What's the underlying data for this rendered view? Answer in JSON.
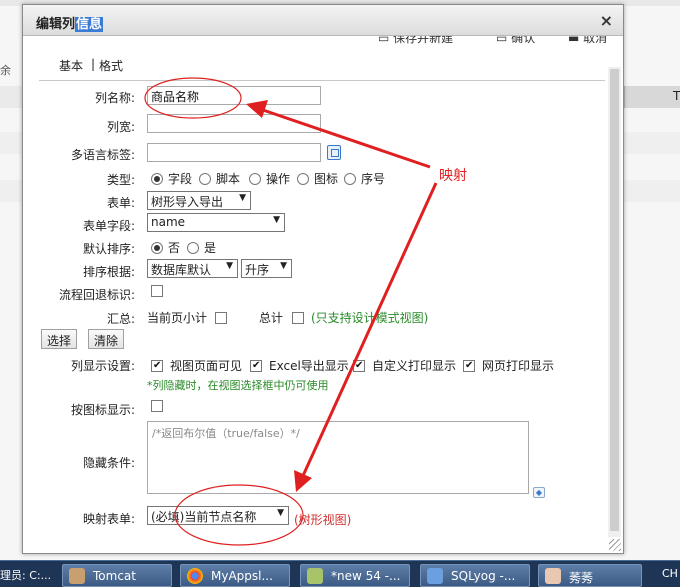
{
  "dialog": {
    "title_prefix": "编辑列",
    "title_selected": "信息",
    "close_label": "×"
  },
  "toolbar": {
    "save_new": "保存并新建",
    "confirm": "确认",
    "cancel": "取消"
  },
  "tabs": {
    "basic": "基本",
    "separator": "|",
    "format": "格式"
  },
  "form": {
    "column_name": {
      "label": "列名称:",
      "value": "商品名称"
    },
    "column_width": {
      "label": "列宽:",
      "value": ""
    },
    "i18n_label": {
      "label": "多语言标签:",
      "value": ""
    },
    "type": {
      "label": "类型:",
      "options": [
        "字段",
        "脚本",
        "操作",
        "图标",
        "序号"
      ],
      "selected": "字段"
    },
    "form_select": {
      "label": "表单:",
      "value": "树形导入导出"
    },
    "form_field": {
      "label": "表单字段:",
      "value": "name"
    },
    "default_sort": {
      "label": "默认排序:",
      "options": [
        "否",
        "是"
      ],
      "selected": "否"
    },
    "sort_by": {
      "label": "排序根据:",
      "value": "数据库默认",
      "order": "升序"
    },
    "flow_back": {
      "label": "流程回退标识:",
      "checked": false
    },
    "summary": {
      "label": "汇总:",
      "page_subtotal": "当前页小计",
      "total": "总计",
      "hint": "(只支持设计模式视图)"
    },
    "buttons": {
      "select": "选择",
      "clear": "清除"
    },
    "display": {
      "label": "列显示设置:",
      "options": [
        "视图页面可见",
        "Excel导出显示",
        "自定义打印显示",
        "网页打印显示"
      ],
      "hint": "*列隐藏时，在视图选择框中仍可使用"
    },
    "icon_display": {
      "label": "按图标显示:",
      "checked": false
    },
    "hide_condition": {
      "label": "隐藏条件:",
      "placeholder": "/*返回布尔值（true/false）*/"
    },
    "mapping_form": {
      "label": "映射表单:",
      "value": "(必填)当前节点名称",
      "hint": "(树形视图)"
    }
  },
  "annotation": {
    "text": "映射",
    "color": "#e02020"
  },
  "background": {
    "right_header": "T",
    "left_label": "余"
  },
  "taskbar": {
    "left_text": "理员: C:...",
    "items": [
      "Tomcat",
      "MyAppsl...",
      "*new 54 -...",
      "SQLyog -...",
      "莠莠"
    ],
    "right_text": "CH"
  }
}
